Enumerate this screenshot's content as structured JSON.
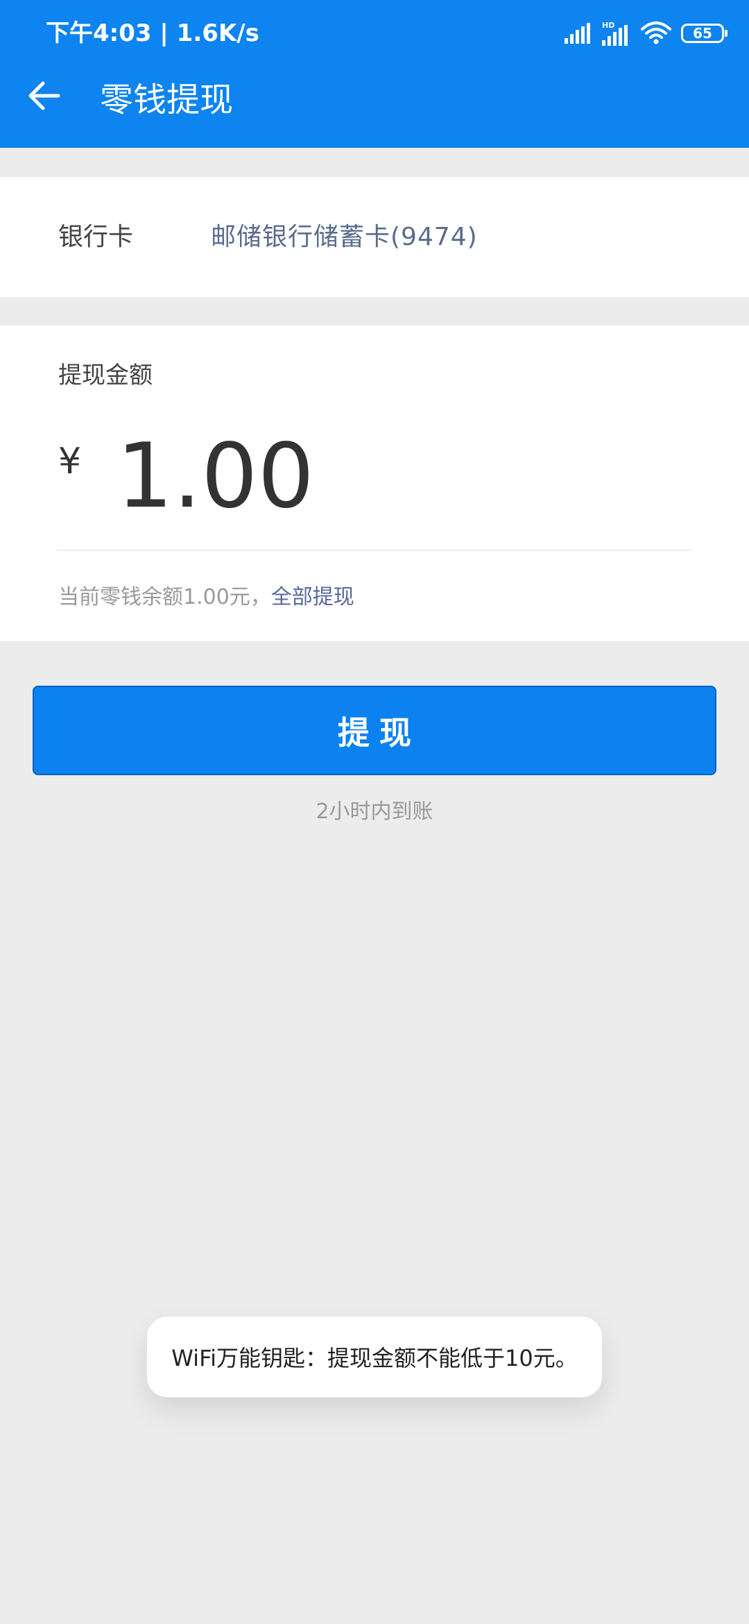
{
  "status_bar": {
    "time_speed": "下午4:03 | 1.6K/s",
    "network_badge": "HD",
    "battery_level": "65",
    "icons": [
      "signal-icon",
      "hd-signal-icon",
      "wifi-icon",
      "battery-icon"
    ]
  },
  "header": {
    "title": "零钱提现",
    "back_icon": "back-arrow-icon"
  },
  "bank_card": {
    "label": "银行卡",
    "value": "邮储银行储蓄卡(9474)"
  },
  "amount": {
    "label": "提现金额",
    "currency": "¥",
    "value": "1.00",
    "balance_text": "当前零钱余额1.00元，",
    "withdraw_all": "全部提现"
  },
  "actions": {
    "withdraw_label": "提现",
    "arrival_note": "2小时内到账"
  },
  "toast": {
    "message": "WiFi万能钥匙：提现金额不能低于10元。"
  },
  "colors": {
    "header_bg": "#0d84ef",
    "button_bg": "#0b82ef",
    "page_bg": "#ececed",
    "link": "#55699a"
  }
}
